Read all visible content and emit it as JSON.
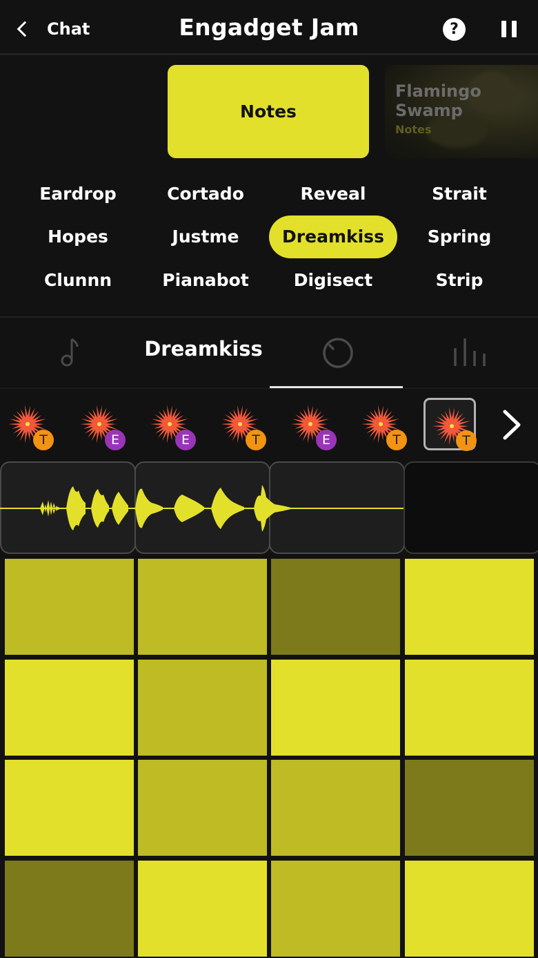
{
  "header": {
    "back_label": "Chat",
    "title": "Engadget Jam",
    "help_icon": "?"
  },
  "kits": {
    "current": "Notes",
    "next_name": "Flamingo Swamp",
    "next_sub": "Notes"
  },
  "instruments": [
    "Eardrop",
    "Cortado",
    "Reveal",
    "Strait",
    "Hopes",
    "Justme",
    "Dreamkiss",
    "Spring",
    "Clunnn",
    "Pianabot",
    "Digisect",
    "Strip"
  ],
  "selected_instrument": "Dreamkiss",
  "tabs": {
    "active_label": "Dreamkiss",
    "icons": [
      "note-icon",
      "knob-icon",
      "mixer-bars-icon"
    ]
  },
  "presets": [
    {
      "badge": "T"
    },
    {
      "badge": "E"
    },
    {
      "badge": "E"
    },
    {
      "badge": "T"
    },
    {
      "badge": "E"
    },
    {
      "badge": "T"
    },
    {
      "badge": "T"
    }
  ],
  "selected_preset": 7,
  "colors": {
    "accent": "#e3e02c",
    "pad_mid": "#bfbb24",
    "pad_dark": "#7d7a1b",
    "badge_t": "#f29314",
    "badge_e": "#9a35b8",
    "flower": "#f2583a"
  },
  "pads": [
    [
      "mid",
      "mid",
      "dark",
      "bright"
    ],
    [
      "bright",
      "mid",
      "bright",
      "bright"
    ],
    [
      "bright",
      "mid",
      "mid",
      "dark"
    ],
    [
      "dark",
      "bright",
      "mid",
      "bright"
    ]
  ]
}
